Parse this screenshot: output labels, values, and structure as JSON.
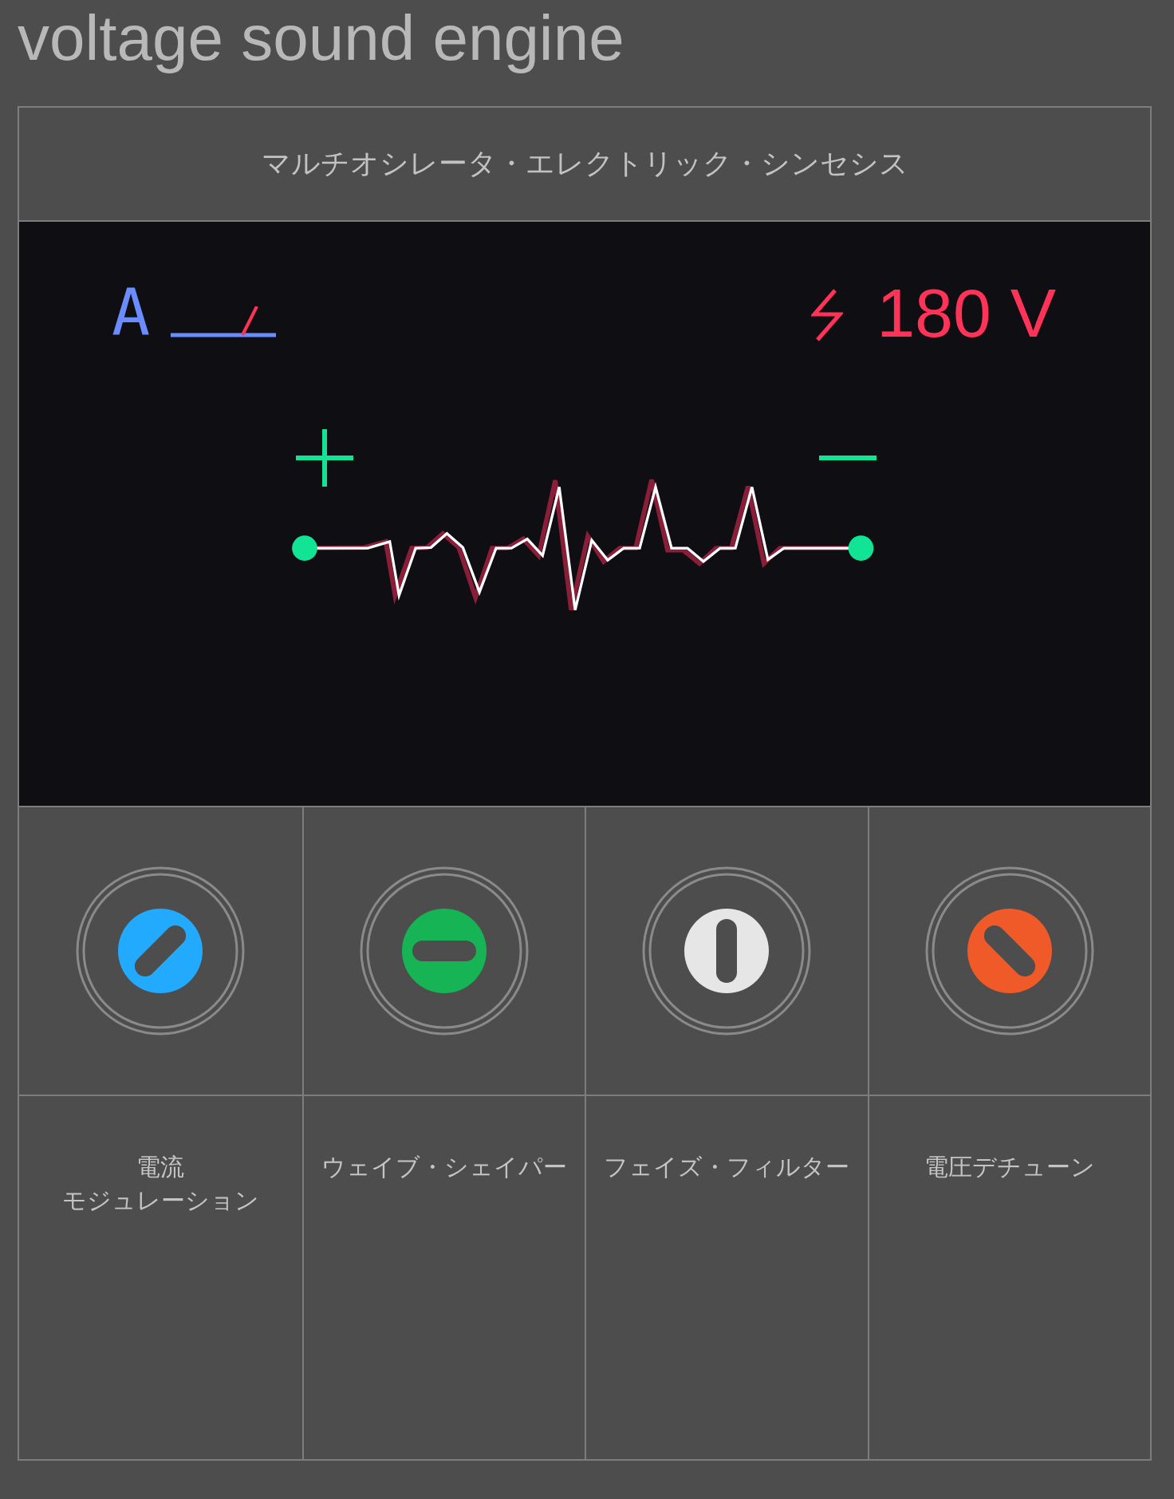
{
  "app_title": "voltage sound engine",
  "panel": {
    "title": "マルチオシレータ・エレクトリック・シンセシス"
  },
  "display": {
    "channel": "A",
    "voltage": "180 V"
  },
  "controls": [
    {
      "label_lines": [
        "電流",
        "モジュレーション"
      ],
      "color": "#22aaff"
    },
    {
      "label_lines": [
        "ウェイブ・シェイパー"
      ],
      "color": "#17b455"
    },
    {
      "label_lines": [
        "フェイズ・フィルター"
      ],
      "color": "#e6e6e6"
    },
    {
      "label_lines": [
        "電圧デチューン"
      ],
      "color": "#f05a28"
    }
  ]
}
